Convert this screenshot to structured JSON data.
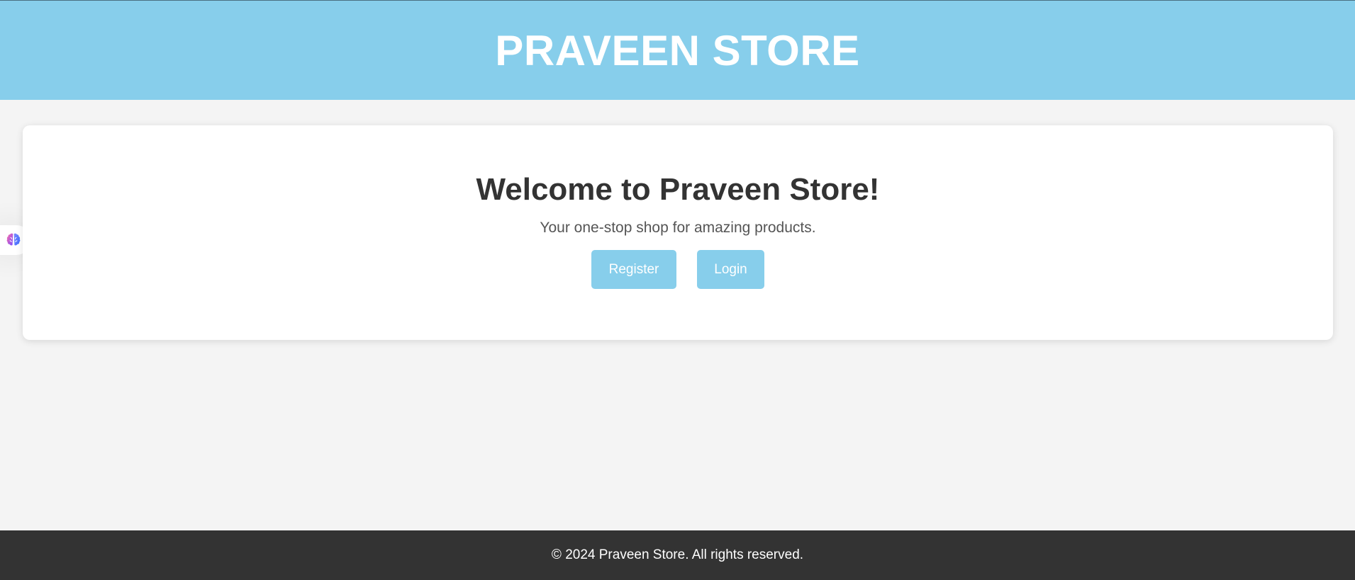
{
  "header": {
    "title": "PRAVEEN STORE"
  },
  "hero": {
    "heading": "Welcome to Praveen Store!",
    "tagline": "Your one-stop shop for amazing products.",
    "register_label": "Register",
    "login_label": "Login"
  },
  "side_widget": {
    "icon": "brain-icon"
  },
  "footer": {
    "copyright": "© 2024 Praveen Store. All rights reserved."
  },
  "colors": {
    "header_bg": "#87ceeb",
    "button_bg": "#87ceeb",
    "footer_bg": "#333333",
    "page_bg": "#f4f4f4"
  }
}
